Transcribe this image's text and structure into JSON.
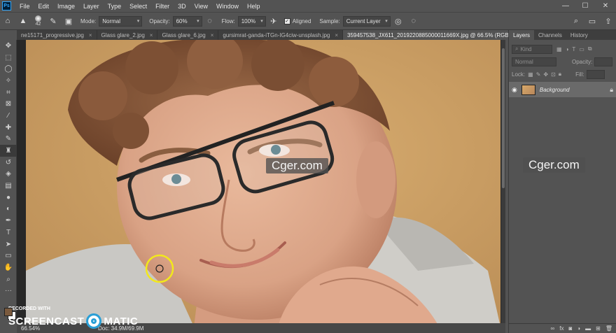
{
  "app": {
    "logo": "Ps"
  },
  "menu": [
    "File",
    "Edit",
    "Image",
    "Layer",
    "Type",
    "Select",
    "Filter",
    "3D",
    "View",
    "Window",
    "Help"
  ],
  "window_controls": {
    "minimize": "—",
    "maximize": "☐",
    "close": "✕"
  },
  "options": {
    "brush_size": "42",
    "mode_label": "Mode:",
    "mode_value": "Normal",
    "opacity_label": "Opacity:",
    "opacity_value": "60%",
    "flow_label": "Flow:",
    "flow_value": "100%",
    "aligned_label": "Aligned",
    "sample_label": "Sample:",
    "sample_value": "Current Layer"
  },
  "tabs": [
    {
      "label": "ne15171_progressive.jpg",
      "close": "×"
    },
    {
      "label": "Glass glare_2.jpg",
      "close": "×"
    },
    {
      "label": "Glass glare_6.jpg",
      "close": "×"
    },
    {
      "label": "gursimrat-ganda-iTGn-IG4ciw-unsplash.jpg",
      "close": "×"
    },
    {
      "label": "359457538_JX611_2019220885000011669X.jpg @ 66.5% (RGB/8#) *",
      "close": "×"
    }
  ],
  "panel": {
    "tabs": [
      "Layers",
      "Channels",
      "History"
    ],
    "kind_placeholder": "Kind",
    "blend_mode": "Normal",
    "opacity_label": "Opacity:",
    "lock_label": "Lock:",
    "fill_label": "Fill:",
    "layer_name": "Background"
  },
  "status": {
    "zoom": "66.54%",
    "doc": "Doc: 34.9M/69.9M"
  },
  "watermarks": [
    "Cger.com",
    "Cger.com"
  ],
  "recorder": {
    "top": "RECORDED WITH",
    "left": "SCREENCAST",
    "right": "MATIC"
  },
  "colors": {
    "foreground": "#7a5a3e",
    "background": "#ffffff",
    "accent": "#31a8ff"
  }
}
